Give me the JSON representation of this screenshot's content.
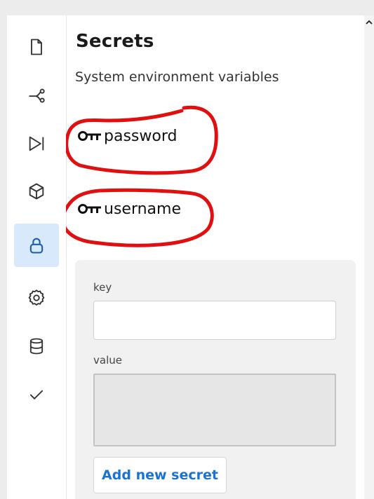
{
  "panel": {
    "title": "Secrets",
    "subtitle": "System environment variables"
  },
  "secrets": [
    {
      "name": "password"
    },
    {
      "name": "username"
    }
  ],
  "form": {
    "key_label": "key",
    "key_value": "",
    "value_label": "value",
    "value_value": "",
    "add_button_label": "Add new secret"
  },
  "activity_bar": [
    {
      "icon": "file-icon"
    },
    {
      "icon": "git-branch-icon"
    },
    {
      "icon": "run-debug-icon"
    },
    {
      "icon": "package-cube-icon"
    },
    {
      "icon": "lock-icon",
      "active": true
    },
    {
      "icon": "gear-icon"
    },
    {
      "icon": "database-icon"
    },
    {
      "icon": "checkmark-icon"
    }
  ],
  "colors": {
    "accent": "#1a73d2",
    "active_bg": "#d7e9fb",
    "annotation": "#e01010",
    "form_bg": "#f1f1f1"
  }
}
